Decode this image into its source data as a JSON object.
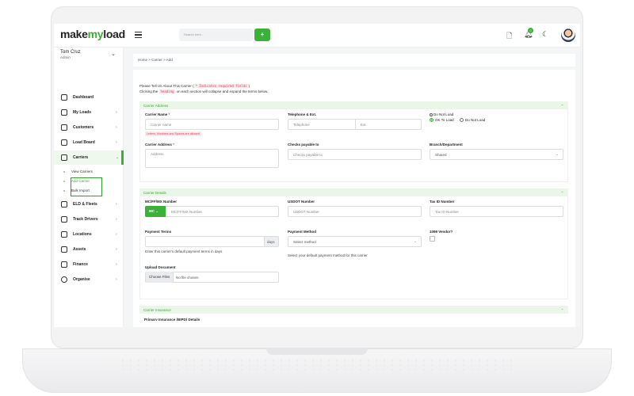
{
  "app": {
    "logo_pre": "make",
    "logo_my": "my",
    "logo_post": "load",
    "search_placeholder": "Search here..",
    "search_btn": "+",
    "notification_count": "0"
  },
  "user": {
    "name": "Tom Cruz",
    "role": "Admin"
  },
  "sidebar": {
    "items": [
      {
        "label": "Dashboard"
      },
      {
        "label": "My Loads"
      },
      {
        "label": "Customers"
      },
      {
        "label": "Load Board"
      },
      {
        "label": "Carriers"
      },
      {
        "label": "ELD & Fleets"
      },
      {
        "label": "Track Drivers"
      },
      {
        "label": "Locations"
      },
      {
        "label": "Assets"
      },
      {
        "label": "Finance"
      },
      {
        "label": "Organise"
      }
    ],
    "carrier_sub": [
      "View Carriers",
      "Add Carrier",
      "Bulk Import"
    ]
  },
  "breadcrumb": "Home > Carrier > Add",
  "intro": {
    "line1_pre": "Please Tell Us About This Carrier (",
    "line1_code": "* Indicates required fields",
    "line1_post": ")",
    "line2_pre": "Clicking the",
    "line2_code": "heading",
    "line2_post": "on each section will collapse and expand the terms below."
  },
  "sections": {
    "address": "Carrier Address",
    "details": "Carrier Details",
    "insurance": "Carrier Insurance",
    "collapse_icon": "−"
  },
  "address_form": {
    "carrier_name_label": "Carrier Name",
    "carrier_name_placeholder": "Carrier name",
    "carrier_name_error": "Letters, Numbers and Spaces are allowed",
    "telephone_label": "Telephone & Ext.",
    "telephone_placeholder": "Telephone",
    "ext_placeholder": "Ext.",
    "do_not_load_label": "Do Not Load",
    "ok_to_load": "OK To Load",
    "do_not_load": "Do Not Load",
    "carrier_address_label": "Carrier Address",
    "address_placeholder": "Address",
    "checks_label": "Checks payable to",
    "checks_placeholder": "Checks payable to",
    "branch_label": "Branch/Department",
    "branch_value": "Shared"
  },
  "details_form": {
    "mc_label": "MC/FF/MX Number",
    "mc_prefix": "MC",
    "mc_placeholder": "MC/FF/MX Number",
    "usdot_label": "USDOT Number",
    "usdot_placeholder": "USDOT Number",
    "taxid_label": "Tax ID Number",
    "taxid_placeholder": "Tax ID Number",
    "payment_terms_label": "Payment Terms",
    "days_addon": "days",
    "payment_terms_help": "Enter this carrier's default payment terms in days",
    "payment_method_label": "Payment Method",
    "payment_method_value": "Select method",
    "payment_method_help": "Select your default payment method for this carrier",
    "vendor_label": "1099 Vendor?",
    "upload_label": "Upload Document",
    "choose_files": "Choose Files",
    "no_file": "No file chosen"
  },
  "insurance_form": {
    "primary_label": "Primary Insurance (BIPD) Details"
  }
}
